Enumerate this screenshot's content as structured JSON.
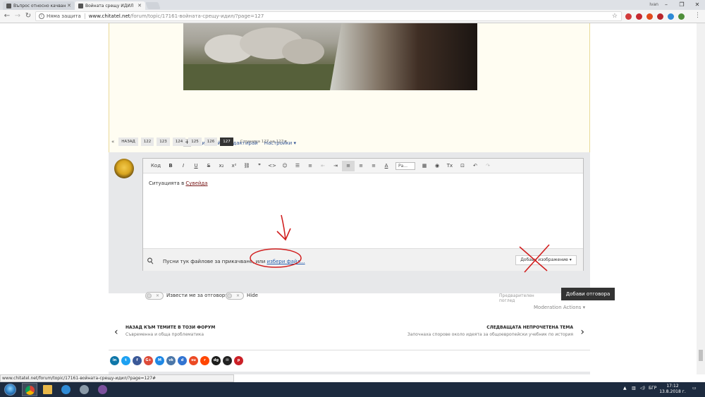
{
  "browser": {
    "tabs": [
      {
        "label": "Въпрос относно качван"
      },
      {
        "label": "Войната срещу ИДИЛ"
      }
    ],
    "user_name": "Ivan",
    "address": {
      "security_text": "Няма защита",
      "host": "www.chitatel.net",
      "path": "/forum/topic/17161-войната-срещу-идил/?page=127"
    },
    "status_url": "www.chitatel.net/forum/topic/17161-войната-срещу-идил/?page=127#"
  },
  "post_actions": {
    "quote": "Цитирай",
    "edit": "Редактирай",
    "settings": "Настройки ▾"
  },
  "pagination": {
    "prev_arrow": "«",
    "prev_label": "НАЗАД",
    "pages": [
      "122",
      "123",
      "124",
      "125",
      "126",
      "127"
    ],
    "current": "127",
    "info": "Страница 127 на 127 ▾"
  },
  "editor": {
    "toolbar": {
      "source": "Код",
      "bold": "B",
      "italic": "I",
      "underline": "U",
      "strike": "S",
      "subscript": "x₂",
      "superscript": "x²",
      "link": "⛓",
      "quote": "❞",
      "code": "<>",
      "emoji": "☺",
      "bullets": "☰",
      "numbered": "≡",
      "outdent": "⇤",
      "indent": "⇥",
      "align_left": "≡",
      "align_center": "≡",
      "align_right": "≡",
      "font_color": "A",
      "font_size_select": "Ра...",
      "table": "▦",
      "preview": "◉",
      "clear_format": "Tx",
      "find": "⊡",
      "undo": "↶",
      "redo": "↷"
    },
    "text_prefix": "Ситуацията в ",
    "text_link": "Сувейда",
    "attach_text": "Пусни тук файлове за прикачване, или ",
    "attach_link": "избери файл...",
    "add_image": "Добави изображение ▾",
    "notify_label": "Извести ме за отговори",
    "hide_label": "Hide",
    "preview_label": "Предварителен поглед",
    "submit_label": "Добави отговора"
  },
  "moderation_actions": "Moderation Actions ▾",
  "thread_nav": {
    "prev_title": "НАЗАД КЪМ ТЕМИТЕ В ТОЗИ ФОРУМ",
    "prev_sub": "Съвременна и обща проблематика",
    "next_title": "СЛЕДВАЩАТА НЕПРОЧЕТЕНА ТЕМА",
    "next_sub": "Започнаха спорове около идеята за общоевропейски учебник по история"
  },
  "share_buttons": [
    {
      "name": "linkedin",
      "glyph": "in",
      "color": "#0e76a8"
    },
    {
      "name": "twitter",
      "glyph": "t",
      "color": "#1da1f2"
    },
    {
      "name": "facebook",
      "glyph": "f",
      "color": "#3b5998"
    },
    {
      "name": "google-plus",
      "glyph": "G+",
      "color": "#dd4b39"
    },
    {
      "name": "myspace",
      "glyph": "M",
      "color": "#1e88e5"
    },
    {
      "name": "vk",
      "glyph": "vk",
      "color": "#4a76a8"
    },
    {
      "name": "delicious",
      "glyph": "d",
      "color": "#3274d1"
    },
    {
      "name": "stumbleupon",
      "glyph": "su",
      "color": "#eb4924"
    },
    {
      "name": "reddit",
      "glyph": "r",
      "color": "#ff4500"
    },
    {
      "name": "digg",
      "glyph": "dg",
      "color": "#1d1d1b"
    },
    {
      "name": "email",
      "glyph": "✉",
      "color": "#222222"
    },
    {
      "name": "pinterest",
      "glyph": "p",
      "color": "#cb2027"
    }
  ],
  "taskbar": {
    "language": "БГР",
    "time": "17:12",
    "date": "13.8.2018 г."
  }
}
